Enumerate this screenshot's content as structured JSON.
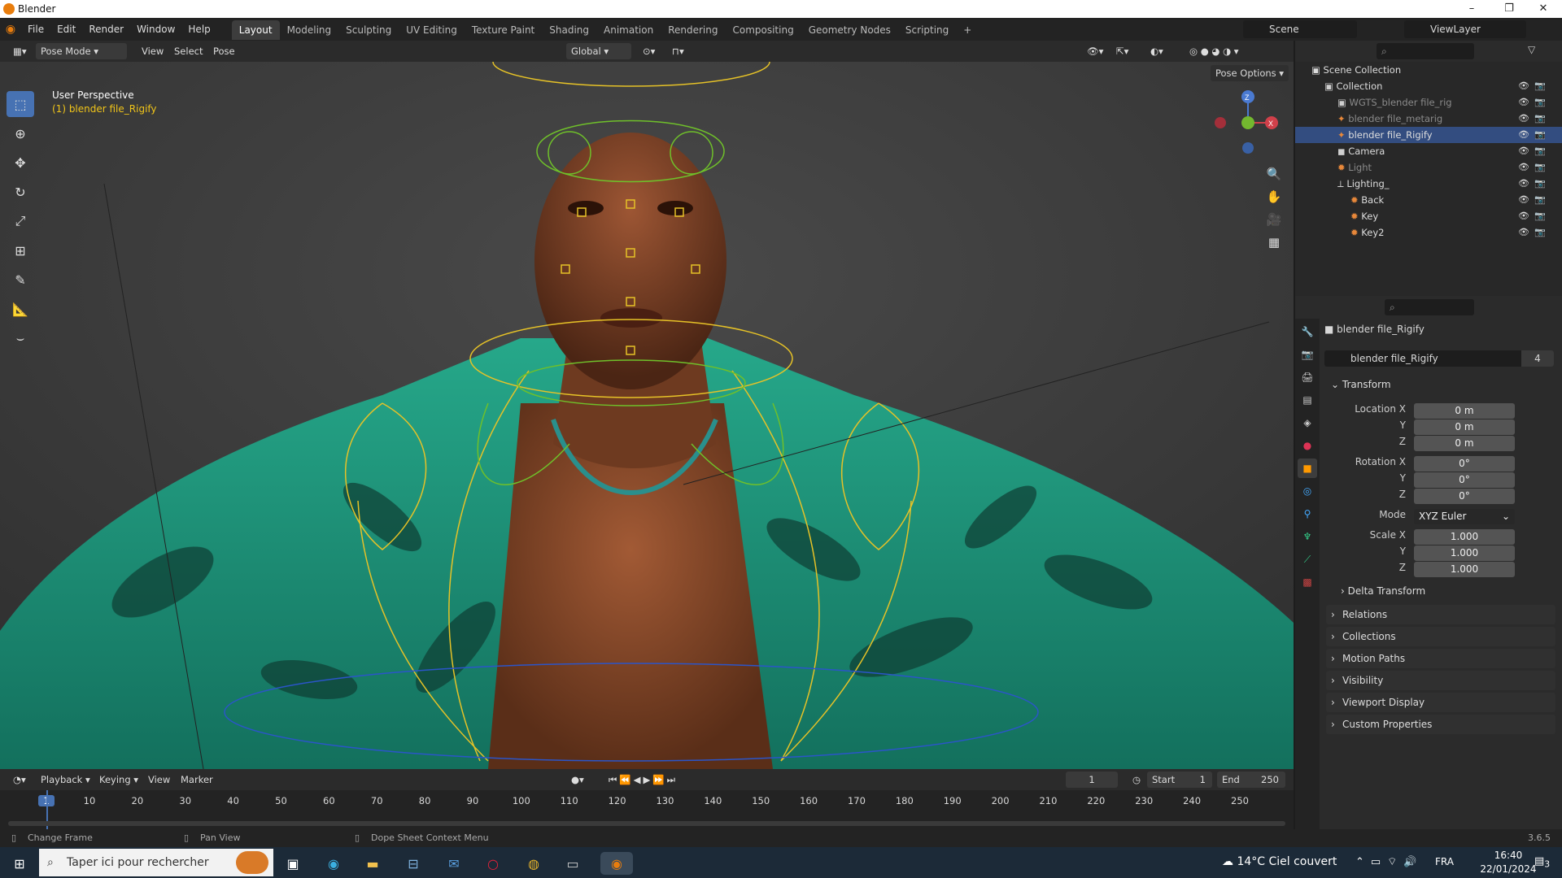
{
  "window": {
    "title": "Blender",
    "controls": [
      "–",
      "❐",
      "✕"
    ]
  },
  "menus": [
    "File",
    "Edit",
    "Render",
    "Window",
    "Help"
  ],
  "workspaces": [
    "Layout",
    "Modeling",
    "Sculpting",
    "UV Editing",
    "Texture Paint",
    "Shading",
    "Animation",
    "Rendering",
    "Compositing",
    "Geometry Nodes",
    "Scripting",
    "+"
  ],
  "scene": {
    "name": "Scene",
    "viewlayer": "ViewLayer"
  },
  "viewport": {
    "mode": "Pose Mode",
    "menus": [
      "View",
      "Select",
      "Pose"
    ],
    "orientation": "Global",
    "pose_options": "Pose Options",
    "overlay_title": "User Perspective",
    "overlay_object": "(1) blender file_Rigify",
    "gizmo_axes": [
      "Z",
      "X"
    ]
  },
  "outliner": {
    "root": "Scene Collection",
    "rows": [
      {
        "label": "Collection",
        "depth": 1,
        "icon": "collection-icon"
      },
      {
        "label": "WGTS_blender file_rig",
        "depth": 2,
        "icon": "collection-icon",
        "dim": true
      },
      {
        "label": "blender file_metarig",
        "depth": 2,
        "icon": "armature-icon",
        "dim": true
      },
      {
        "label": "blender file_Rigify",
        "depth": 2,
        "icon": "armature-icon",
        "selected": true
      },
      {
        "label": "Camera",
        "depth": 2,
        "icon": "camera-icon"
      },
      {
        "label": "Light",
        "depth": 2,
        "icon": "light-icon",
        "dim": true
      },
      {
        "label": "Lighting_",
        "depth": 2,
        "icon": "empty-icon"
      },
      {
        "label": "Back",
        "depth": 3,
        "icon": "light-icon"
      },
      {
        "label": "Key",
        "depth": 3,
        "icon": "light-icon"
      },
      {
        "label": "Key2",
        "depth": 3,
        "icon": "light-icon"
      }
    ]
  },
  "properties": {
    "object_name": "blender file_Rigify",
    "datablock": "blender file_Rigify",
    "users": "4",
    "transform_title": "Transform",
    "location": {
      "label": "Location X",
      "x": "0 m",
      "y": "0 m",
      "z": "0 m"
    },
    "rotation": {
      "label": "Rotation X",
      "x": "0°",
      "y": "0°",
      "z": "0°"
    },
    "mode_label": "Mode",
    "mode_value": "XYZ Euler",
    "scale": {
      "label": "Scale X",
      "x": "1.000",
      "y": "1.000",
      "z": "1.000"
    },
    "axis_y": "Y",
    "axis_z": "Z",
    "delta": "Delta Transform",
    "panels": [
      "Relations",
      "Collections",
      "Motion Paths",
      "Visibility",
      "Viewport Display",
      "Custom Properties"
    ]
  },
  "timeline": {
    "menus": [
      "Playback",
      "Keying",
      "View",
      "Marker"
    ],
    "current_frame": "1",
    "start_label": "Start",
    "start": "1",
    "end_label": "End",
    "end": "250",
    "ticks": [
      "1",
      "10",
      "20",
      "30",
      "40",
      "50",
      "60",
      "70",
      "80",
      "90",
      "100",
      "110",
      "120",
      "130",
      "140",
      "150",
      "160",
      "170",
      "180",
      "190",
      "200",
      "210",
      "220",
      "230",
      "240",
      "250"
    ]
  },
  "status": {
    "left": "Change Frame",
    "mid": "Pan View",
    "right": "Dope Sheet Context Menu",
    "version": "3.6.5"
  },
  "taskbar": {
    "search": "Taper ici pour rechercher",
    "weather": "14°C Ciel couvert",
    "lang": "FRA",
    "time": "16:40",
    "date": "22/01/2024",
    "notif": "3"
  },
  "colors": {
    "accent": "#4772b3",
    "bone": "#e6c227",
    "bone_fk": "#6fc02a",
    "shirt": "#1f9c80",
    "skin": "#8a4a2c"
  }
}
